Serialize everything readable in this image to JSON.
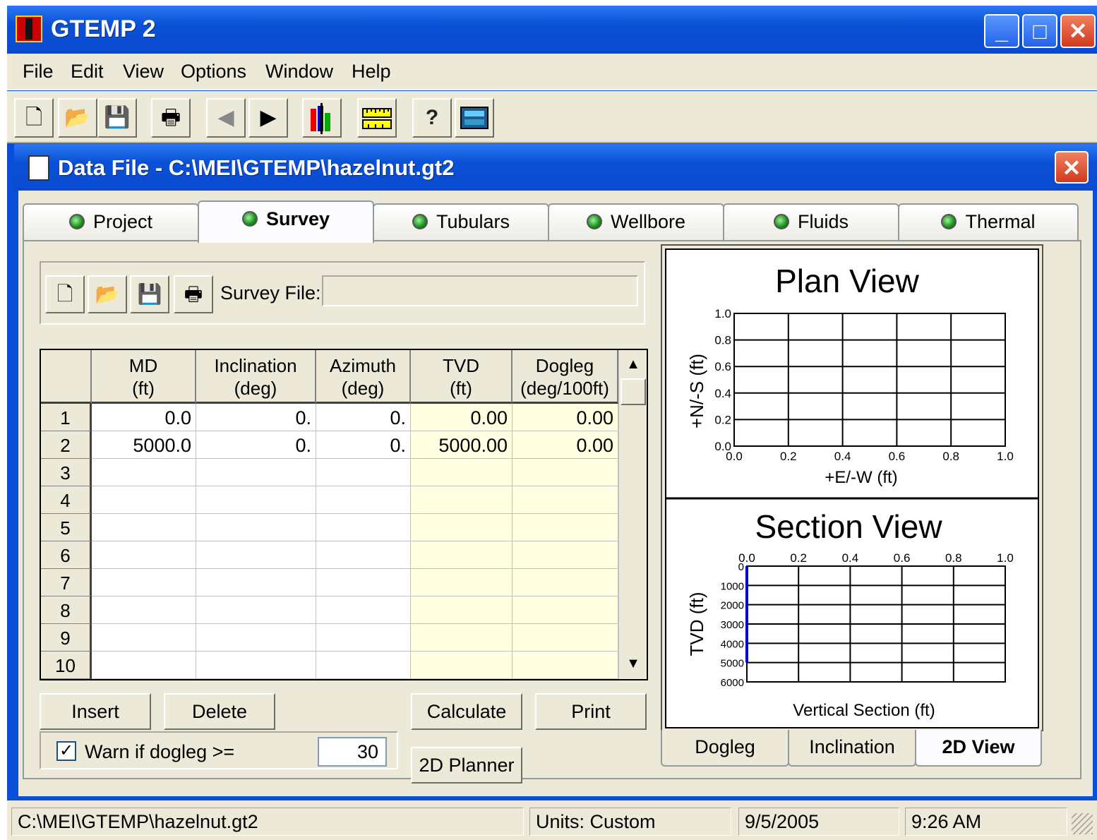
{
  "window": {
    "title": "GTEMP 2",
    "min_glyph": "_",
    "max_glyph": "□",
    "close_glyph": "✕"
  },
  "menu": [
    "File",
    "Edit",
    "View",
    "Options",
    "Window",
    "Help"
  ],
  "toolbar": {
    "icons": [
      "new-icon",
      "open-icon",
      "save-icon",
      "print-icon",
      "back-icon",
      "forward-icon",
      "chart-icon",
      "ruler-icon",
      "help-icon",
      "calculator-icon"
    ]
  },
  "child": {
    "title": "Data File - C:\\MEI\\GTEMP\\hazelnut.gt2",
    "close_glyph": "✕"
  },
  "tabs": [
    "Project",
    "Survey",
    "Tubulars",
    "Wellbore",
    "Fluids",
    "Thermal"
  ],
  "survey": {
    "file_label": "Survey File:",
    "file_value": "",
    "columns": [
      {
        "line1": "MD",
        "line2": "(ft)"
      },
      {
        "line1": "Inclination",
        "line2": "(deg)"
      },
      {
        "line1": "Azimuth",
        "line2": "(deg)"
      },
      {
        "line1": "TVD",
        "line2": "(ft)"
      },
      {
        "line1": "Dogleg",
        "line2": "(deg/100ft)"
      }
    ],
    "row_numbers": [
      "1",
      "2",
      "3",
      "4",
      "5",
      "6",
      "7",
      "8",
      "9",
      "10"
    ],
    "rows": [
      [
        "0.0",
        "0.",
        "0.",
        "0.00",
        "0.00"
      ],
      [
        "5000.0",
        "0.",
        "0.",
        "5000.00",
        "0.00"
      ],
      [
        "",
        "",
        "",
        "",
        ""
      ],
      [
        "",
        "",
        "",
        "",
        ""
      ],
      [
        "",
        "",
        "",
        "",
        ""
      ],
      [
        "",
        "",
        "",
        "",
        ""
      ],
      [
        "",
        "",
        "",
        "",
        ""
      ],
      [
        "",
        "",
        "",
        "",
        ""
      ],
      [
        "",
        "",
        "",
        "",
        ""
      ],
      [
        "",
        "",
        "",
        "",
        ""
      ]
    ],
    "buttons": {
      "insert": "Insert",
      "delete": "Delete",
      "calculate": "Calculate",
      "print": "Print",
      "planner": "2D Planner"
    },
    "warn_label": "Warn if dogleg >=",
    "warn_checked": "✓",
    "warn_value": "30"
  },
  "plan_view": {
    "title": "Plan View",
    "xlabel": "+E/-W (ft)",
    "ylabel": "+N/-S (ft)",
    "xticks": [
      "0.0",
      "0.2",
      "0.4",
      "0.6",
      "0.8",
      "1.0"
    ],
    "yticks": [
      "1.0",
      "0.8",
      "0.6",
      "0.4",
      "0.2",
      "0.0"
    ]
  },
  "section_view": {
    "title": "Section View",
    "xlabel": "Vertical Section (ft)",
    "ylabel": "TVD (ft)",
    "xticks": [
      "0.0",
      "0.2",
      "0.4",
      "0.6",
      "0.8",
      "1.0"
    ],
    "yticks": [
      "0",
      "1000",
      "2000",
      "3000",
      "4000",
      "5000",
      "6000"
    ]
  },
  "view_tabs": [
    "Dogleg",
    "Inclination",
    "2D View"
  ],
  "status": {
    "path": "C:\\MEI\\GTEMP\\hazelnut.gt2",
    "units": "Units: Custom",
    "date": "9/5/2005",
    "time": "9:26 AM"
  },
  "colors": {
    "titlebar": "#0a4ed8",
    "face": "#ece9d8",
    "calc_cell": "#ffffe1",
    "trajectory": "#0000cc"
  }
}
